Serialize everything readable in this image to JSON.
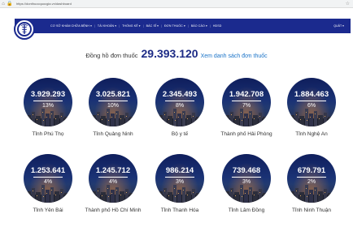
{
  "browser": {
    "url": "https://donthuocquocgia.vn/dashboard"
  },
  "nav": {
    "items": [
      "CƠ SỞ KHÁM CHỮA BỆNH ▾",
      "TÀI KHOẢN ▾",
      "THỐNG KÊ ▾",
      "BÁC SĨ ▾",
      "ĐƠN THUỐC ▾",
      "BÁO CÁO ▾",
      "HDSD"
    ],
    "right": "QUẢT ▾"
  },
  "counter": {
    "label": "Đồng hồ đơn thuốc",
    "value": "29.393.120",
    "link": "Xem danh sách đơn thuốc"
  },
  "stats": [
    {
      "value": "3.929.293",
      "percent": "13%",
      "name": "Tỉnh Phú Thọ"
    },
    {
      "value": "3.025.821",
      "percent": "10%",
      "name": "Tỉnh Quảng Ninh"
    },
    {
      "value": "2.345.493",
      "percent": "8%",
      "name": "Bộ y tế"
    },
    {
      "value": "1.942.708",
      "percent": "7%",
      "name": "Thành phố Hải Phòng"
    },
    {
      "value": "1.884.463",
      "percent": "6%",
      "name": "Tỉnh Nghệ An"
    },
    {
      "value": "1.253.641",
      "percent": "4%",
      "name": "Tỉnh Yên Bái"
    },
    {
      "value": "1.245.712",
      "percent": "4%",
      "name": "Thành phố Hồ Chí Minh"
    },
    {
      "value": "986.214",
      "percent": "3%",
      "name": "Tỉnh Thanh Hóa"
    },
    {
      "value": "739.468",
      "percent": "3%",
      "name": "Tỉnh Lâm Đồng"
    },
    {
      "value": "679.791",
      "percent": "2%",
      "name": "Tỉnh Ninh Thuận"
    }
  ]
}
